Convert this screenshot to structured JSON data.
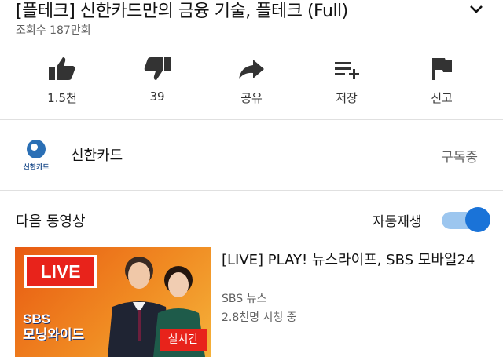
{
  "video": {
    "title": "[플테크] 신한카드만의 금융 기술, 플테크 (Full)",
    "views": "조회수 187만회"
  },
  "actions": [
    {
      "icon": "thumbs-up-icon",
      "label": "1.5천"
    },
    {
      "icon": "thumbs-down-icon",
      "label": "39"
    },
    {
      "icon": "share-icon",
      "label": "공유"
    },
    {
      "icon": "save-playlist-icon",
      "label": "저장"
    },
    {
      "icon": "flag-icon",
      "label": "신고"
    }
  ],
  "channel": {
    "name": "신한카드",
    "logo_text": "신한카드",
    "subscribe_status": "구독중"
  },
  "up_next": {
    "label": "다음 동영상",
    "autoplay_label": "자동재생",
    "autoplay_on": true
  },
  "next_video": {
    "title": "[LIVE] PLAY! 뉴스라이프, SBS 모바일24",
    "channel": "SBS 뉴스",
    "views": "2.8천명 시청 중",
    "thumb_badge": "LIVE",
    "thumb_program": "SBS\n모닝와이드",
    "thumb_realtime": "실시간"
  },
  "colors": {
    "accent": "#1a73d8",
    "toggle_track": "#9cc6ef",
    "live_red": "#e8231b"
  }
}
